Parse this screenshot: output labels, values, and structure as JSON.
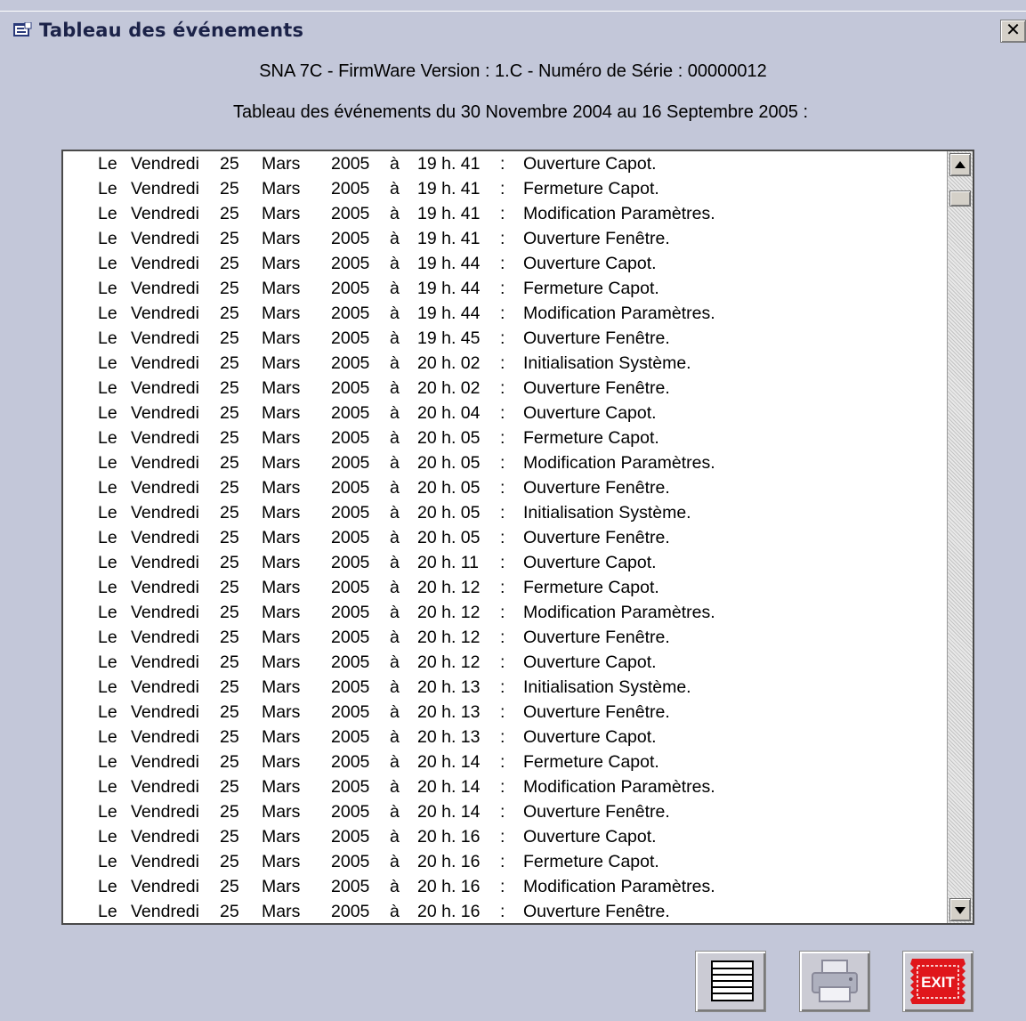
{
  "window": {
    "title": "Tableau des événements",
    "close_label": "✕"
  },
  "header": {
    "device_info": "SNA 7C - FirmWare Version : 1.C - Numéro de Série : 00000012",
    "period": "Tableau des événements du 30 Novembre  2004 au 16 Septembre 2005 :"
  },
  "events": [
    {
      "le": "Le",
      "day": "Vendredi",
      "date": "25",
      "month": "Mars",
      "year": "2005",
      "a": "à",
      "time": "19 h. 41",
      "colon": ":",
      "event": "Ouverture Capot."
    },
    {
      "le": "Le",
      "day": "Vendredi",
      "date": "25",
      "month": "Mars",
      "year": "2005",
      "a": "à",
      "time": "19 h. 41",
      "colon": ":",
      "event": "Fermeture Capot."
    },
    {
      "le": "Le",
      "day": "Vendredi",
      "date": "25",
      "month": "Mars",
      "year": "2005",
      "a": "à",
      "time": "19 h. 41",
      "colon": ":",
      "event": "Modification Paramètres."
    },
    {
      "le": "Le",
      "day": "Vendredi",
      "date": "25",
      "month": "Mars",
      "year": "2005",
      "a": "à",
      "time": "19 h. 41",
      "colon": ":",
      "event": "Ouverture Fenêtre."
    },
    {
      "le": "Le",
      "day": "Vendredi",
      "date": "25",
      "month": "Mars",
      "year": "2005",
      "a": "à",
      "time": "19 h. 44",
      "colon": ":",
      "event": "Ouverture Capot."
    },
    {
      "le": "Le",
      "day": "Vendredi",
      "date": "25",
      "month": "Mars",
      "year": "2005",
      "a": "à",
      "time": "19 h. 44",
      "colon": ":",
      "event": "Fermeture Capot."
    },
    {
      "le": "Le",
      "day": "Vendredi",
      "date": "25",
      "month": "Mars",
      "year": "2005",
      "a": "à",
      "time": "19 h. 44",
      "colon": ":",
      "event": "Modification Paramètres."
    },
    {
      "le": "Le",
      "day": "Vendredi",
      "date": "25",
      "month": "Mars",
      "year": "2005",
      "a": "à",
      "time": "19 h. 45",
      "colon": ":",
      "event": "Ouverture Fenêtre."
    },
    {
      "le": "Le",
      "day": "Vendredi",
      "date": "25",
      "month": "Mars",
      "year": "2005",
      "a": "à",
      "time": "20 h. 02",
      "colon": ":",
      "event": "Initialisation Système."
    },
    {
      "le": "Le",
      "day": "Vendredi",
      "date": "25",
      "month": "Mars",
      "year": "2005",
      "a": "à",
      "time": "20 h. 02",
      "colon": ":",
      "event": "Ouverture Fenêtre."
    },
    {
      "le": "Le",
      "day": "Vendredi",
      "date": "25",
      "month": "Mars",
      "year": "2005",
      "a": "à",
      "time": "20 h. 04",
      "colon": ":",
      "event": "Ouverture Capot."
    },
    {
      "le": "Le",
      "day": "Vendredi",
      "date": "25",
      "month": "Mars",
      "year": "2005",
      "a": "à",
      "time": "20 h. 05",
      "colon": ":",
      "event": "Fermeture Capot."
    },
    {
      "le": "Le",
      "day": "Vendredi",
      "date": "25",
      "month": "Mars",
      "year": "2005",
      "a": "à",
      "time": "20 h. 05",
      "colon": ":",
      "event": "Modification Paramètres."
    },
    {
      "le": "Le",
      "day": "Vendredi",
      "date": "25",
      "month": "Mars",
      "year": "2005",
      "a": "à",
      "time": "20 h. 05",
      "colon": ":",
      "event": "Ouverture Fenêtre."
    },
    {
      "le": "Le",
      "day": "Vendredi",
      "date": "25",
      "month": "Mars",
      "year": "2005",
      "a": "à",
      "time": "20 h. 05",
      "colon": ":",
      "event": "Initialisation Système."
    },
    {
      "le": "Le",
      "day": "Vendredi",
      "date": "25",
      "month": "Mars",
      "year": "2005",
      "a": "à",
      "time": "20 h. 05",
      "colon": ":",
      "event": "Ouverture Fenêtre."
    },
    {
      "le": "Le",
      "day": "Vendredi",
      "date": "25",
      "month": "Mars",
      "year": "2005",
      "a": "à",
      "time": "20 h. 11",
      "colon": ":",
      "event": "Ouverture Capot."
    },
    {
      "le": "Le",
      "day": "Vendredi",
      "date": "25",
      "month": "Mars",
      "year": "2005",
      "a": "à",
      "time": "20 h. 12",
      "colon": ":",
      "event": "Fermeture Capot."
    },
    {
      "le": "Le",
      "day": "Vendredi",
      "date": "25",
      "month": "Mars",
      "year": "2005",
      "a": "à",
      "time": "20 h. 12",
      "colon": ":",
      "event": "Modification Paramètres."
    },
    {
      "le": "Le",
      "day": "Vendredi",
      "date": "25",
      "month": "Mars",
      "year": "2005",
      "a": "à",
      "time": "20 h. 12",
      "colon": ":",
      "event": "Ouverture Fenêtre."
    },
    {
      "le": "Le",
      "day": "Vendredi",
      "date": "25",
      "month": "Mars",
      "year": "2005",
      "a": "à",
      "time": "20 h. 12",
      "colon": ":",
      "event": "Ouverture Capot."
    },
    {
      "le": "Le",
      "day": "Vendredi",
      "date": "25",
      "month": "Mars",
      "year": "2005",
      "a": "à",
      "time": "20 h. 13",
      "colon": ":",
      "event": "Initialisation Système."
    },
    {
      "le": "Le",
      "day": "Vendredi",
      "date": "25",
      "month": "Mars",
      "year": "2005",
      "a": "à",
      "time": "20 h. 13",
      "colon": ":",
      "event": "Ouverture Fenêtre."
    },
    {
      "le": "Le",
      "day": "Vendredi",
      "date": "25",
      "month": "Mars",
      "year": "2005",
      "a": "à",
      "time": "20 h. 13",
      "colon": ":",
      "event": "Ouverture Capot."
    },
    {
      "le": "Le",
      "day": "Vendredi",
      "date": "25",
      "month": "Mars",
      "year": "2005",
      "a": "à",
      "time": "20 h. 14",
      "colon": ":",
      "event": "Fermeture Capot."
    },
    {
      "le": "Le",
      "day": "Vendredi",
      "date": "25",
      "month": "Mars",
      "year": "2005",
      "a": "à",
      "time": "20 h. 14",
      "colon": ":",
      "event": "Modification Paramètres."
    },
    {
      "le": "Le",
      "day": "Vendredi",
      "date": "25",
      "month": "Mars",
      "year": "2005",
      "a": "à",
      "time": "20 h. 14",
      "colon": ":",
      "event": "Ouverture Fenêtre."
    },
    {
      "le": "Le",
      "day": "Vendredi",
      "date": "25",
      "month": "Mars",
      "year": "2005",
      "a": "à",
      "time": "20 h. 16",
      "colon": ":",
      "event": "Ouverture Capot."
    },
    {
      "le": "Le",
      "day": "Vendredi",
      "date": "25",
      "month": "Mars",
      "year": "2005",
      "a": "à",
      "time": "20 h. 16",
      "colon": ":",
      "event": "Fermeture Capot."
    },
    {
      "le": "Le",
      "day": "Vendredi",
      "date": "25",
      "month": "Mars",
      "year": "2005",
      "a": "à",
      "time": "20 h. 16",
      "colon": ":",
      "event": "Modification Paramètres."
    },
    {
      "le": "Le",
      "day": "Vendredi",
      "date": "25",
      "month": "Mars",
      "year": "2005",
      "a": "à",
      "time": "20 h. 16",
      "colon": ":",
      "event": "Ouverture Fenêtre."
    }
  ],
  "toolbar": {
    "list_icon": "list-icon",
    "print_icon": "printer-icon",
    "exit_icon": "exit-icon",
    "exit_label": "EXIT"
  },
  "colors": {
    "background": "#c3c7d9",
    "title_text": "#1b2248",
    "exit_red": "#e0161b"
  }
}
